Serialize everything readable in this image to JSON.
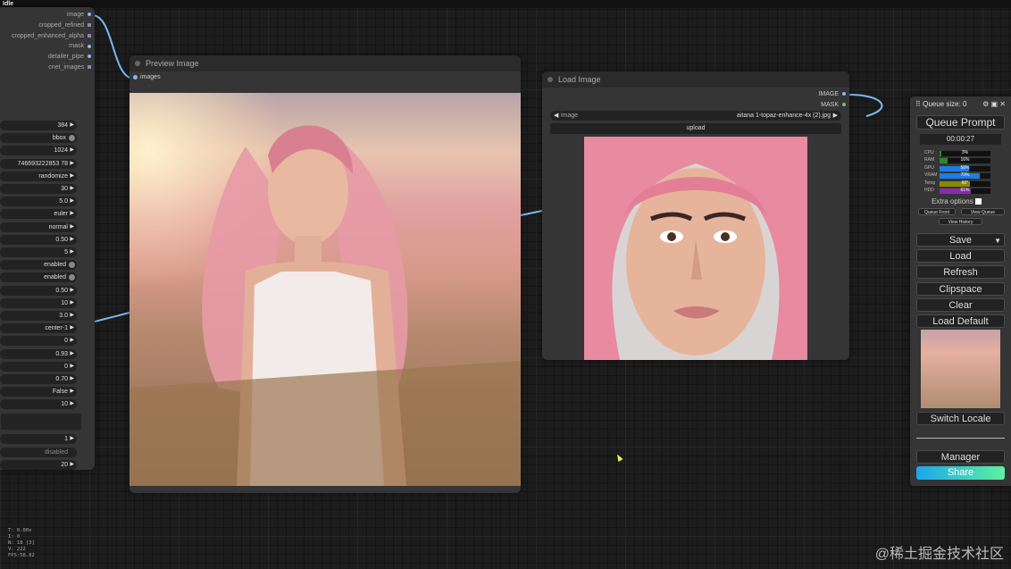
{
  "status": "Idle",
  "left_node": {
    "outputs": [
      "image",
      "cropped_refined",
      "cropped_enhanced_alpha",
      "mask",
      "detailer_pipe",
      "cnet_images"
    ],
    "widgets": [
      "384",
      "bbox",
      "1024",
      "746693222853 78",
      "randomize",
      "30",
      "5.0",
      "euler",
      "normal",
      "0.50",
      "5",
      "enabled",
      "enabled",
      "0.50",
      "10",
      "3.0",
      "center-1",
      "0",
      "0.93",
      "0",
      "0.70",
      "False",
      "10"
    ],
    "widgets_bottom": [
      "1",
      "disabled",
      "20"
    ]
  },
  "preview_node": {
    "title": "Preview Image",
    "input": "images"
  },
  "load_node": {
    "title": "Load Image",
    "outputs": [
      "IMAGE",
      "MASK"
    ],
    "image_label": "image",
    "image_value": "aitana 1-topaz-enhance-4x (2).jpg",
    "upload_label": "upload"
  },
  "menu": {
    "queue_size": "Queue size: 0",
    "queue_prompt": "Queue Prompt",
    "time": "00:00:27",
    "stats": [
      {
        "label": "CPU",
        "pct": "3%",
        "value": 3,
        "color": "#2c8a2c"
      },
      {
        "label": "RAM",
        "pct": "16%",
        "value": 16,
        "color": "#2c8a2c"
      },
      {
        "label": "GPU",
        "pct": "58%",
        "value": 58,
        "color": "#1e7de0"
      },
      {
        "label": "VRAM",
        "pct": "79%",
        "value": 79,
        "color": "#1e7de0"
      },
      {
        "label": "Temp",
        "pct": "60°",
        "value": 60,
        "color": "#8a8a00"
      },
      {
        "label": "HDD",
        "pct": "61%",
        "value": 61,
        "color": "#8c28b4"
      }
    ],
    "extra_options": "Extra options",
    "queue_front": "Queue Front",
    "view_queue": "View Queue",
    "view_history": "View History",
    "save": "Save",
    "load": "Load",
    "refresh": "Refresh",
    "clipspace": "Clipspace",
    "clear": "Clear",
    "load_default": "Load Default",
    "switch_locale": "Switch Locale",
    "manager": "Manager",
    "share": "Share"
  },
  "overlay_stats": [
    "T: 0.00s",
    "I: 0",
    "N: 18 [3]",
    "V: 222",
    "FPS:58.82"
  ],
  "watermark": "@稀土掘金技术社区"
}
